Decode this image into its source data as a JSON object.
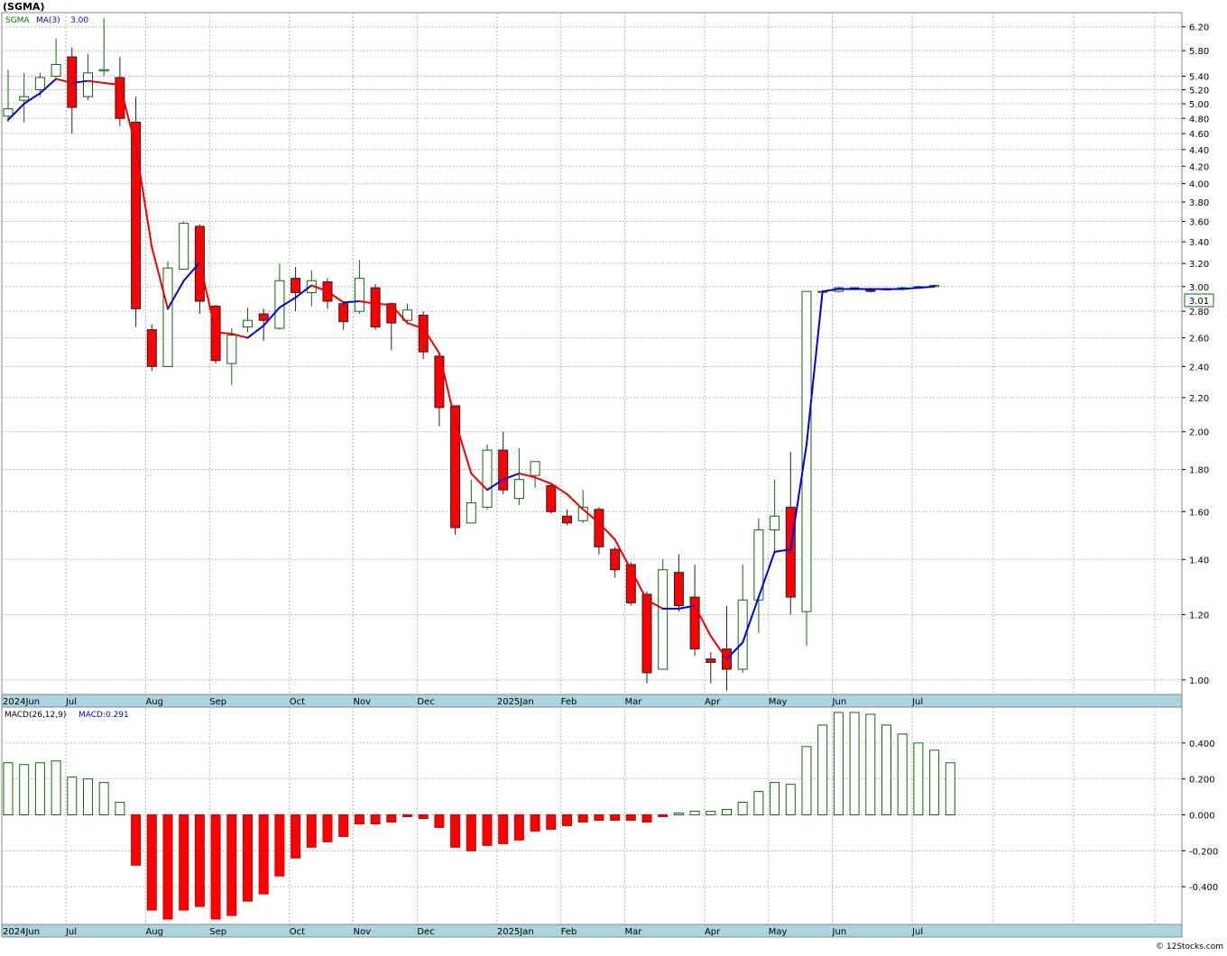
{
  "header": {
    "title": "(SGMA)",
    "legend": [
      {
        "text": "SGMA",
        "color": "#007700"
      },
      {
        "text": "MA(3)",
        "color": "#0000cc"
      },
      {
        "text": "3.00",
        "color": "#0000cc"
      }
    ],
    "last_price": "3.01",
    "footer": "© 12Stocks.com"
  },
  "colors": {
    "up_candle": "#0a6a0a",
    "down_candle": "#ff0000",
    "ma_up": "#0000dd",
    "ma_down": "#ee0000",
    "grid": "#b8b8b8",
    "axis_strip": "#a9d4e0",
    "macd_up": "#0a6a0a",
    "macd_down": "#ff0000"
  },
  "chart_data": [
    {
      "type": "candlestick",
      "scale": "log",
      "ylim": [
        0.96,
        6.45
      ],
      "y_ticks": [
        "1.00",
        "1.20",
        "1.40",
        "1.60",
        "1.80",
        "2.00",
        "2.20",
        "2.40",
        "2.60",
        "2.80",
        "3.00",
        "3.20",
        "3.40",
        "3.60",
        "3.80",
        "4.00",
        "4.20",
        "4.40",
        "4.60",
        "4.80",
        "5.00",
        "5.20",
        "5.40",
        "5.80",
        "6.20"
      ],
      "x_month_labels": [
        {
          "label": "2024Jun",
          "week": 0
        },
        {
          "label": "Jul",
          "week": 4
        },
        {
          "label": "Aug",
          "week": 9
        },
        {
          "label": "Sep",
          "week": 13
        },
        {
          "label": "Oct",
          "week": 18
        },
        {
          "label": "Nov",
          "week": 22
        },
        {
          "label": "Dec",
          "week": 26
        },
        {
          "label": "2025Jan",
          "week": 31
        },
        {
          "label": "Feb",
          "week": 35
        },
        {
          "label": "Mar",
          "week": 39
        },
        {
          "label": "Apr",
          "week": 44
        },
        {
          "label": "May",
          "week": 48
        },
        {
          "label": "Jun",
          "week": 52
        },
        {
          "label": "Jul",
          "week": 57
        }
      ],
      "candles": [
        {
          "o": 4.83,
          "h": 5.5,
          "l": 4.75,
          "c": 4.93
        },
        {
          "o": 5.05,
          "h": 5.45,
          "l": 4.75,
          "c": 5.1
        },
        {
          "o": 5.2,
          "h": 5.45,
          "l": 5.1,
          "c": 5.38
        },
        {
          "o": 5.4,
          "h": 6.0,
          "l": 5.35,
          "c": 5.58
        },
        {
          "o": 5.7,
          "h": 5.85,
          "l": 4.6,
          "c": 4.95
        },
        {
          "o": 5.1,
          "h": 5.75,
          "l": 5.05,
          "c": 5.45
        },
        {
          "o": 5.48,
          "h": 6.35,
          "l": 5.4,
          "c": 5.5
        },
        {
          "o": 5.38,
          "h": 5.7,
          "l": 4.7,
          "c": 4.8
        },
        {
          "o": 4.75,
          "h": 5.1,
          "l": 2.68,
          "c": 2.82
        },
        {
          "o": 2.66,
          "h": 2.7,
          "l": 2.37,
          "c": 2.4
        },
        {
          "o": 2.4,
          "h": 3.22,
          "l": 2.4,
          "c": 3.16
        },
        {
          "o": 3.15,
          "h": 3.6,
          "l": 3.15,
          "c": 3.58
        },
        {
          "o": 3.55,
          "h": 3.57,
          "l": 2.78,
          "c": 2.88
        },
        {
          "o": 2.84,
          "h": 2.85,
          "l": 2.42,
          "c": 2.44
        },
        {
          "o": 2.42,
          "h": 2.67,
          "l": 2.28,
          "c": 2.62
        },
        {
          "o": 2.68,
          "h": 2.83,
          "l": 2.64,
          "c": 2.73
        },
        {
          "o": 2.78,
          "h": 2.82,
          "l": 2.58,
          "c": 2.73
        },
        {
          "o": 2.67,
          "h": 3.2,
          "l": 2.66,
          "c": 3.05
        },
        {
          "o": 3.07,
          "h": 3.17,
          "l": 2.8,
          "c": 2.95
        },
        {
          "o": 2.95,
          "h": 3.14,
          "l": 2.84,
          "c": 3.05
        },
        {
          "o": 3.04,
          "h": 3.07,
          "l": 2.82,
          "c": 2.88
        },
        {
          "o": 2.86,
          "h": 2.88,
          "l": 2.66,
          "c": 2.72
        },
        {
          "o": 2.8,
          "h": 3.23,
          "l": 2.78,
          "c": 3.07
        },
        {
          "o": 2.99,
          "h": 3.02,
          "l": 2.66,
          "c": 2.68
        },
        {
          "o": 2.86,
          "h": 2.87,
          "l": 2.51,
          "c": 2.71
        },
        {
          "o": 2.73,
          "h": 2.86,
          "l": 2.7,
          "c": 2.81
        },
        {
          "o": 2.77,
          "h": 2.8,
          "l": 2.45,
          "c": 2.5
        },
        {
          "o": 2.47,
          "h": 2.47,
          "l": 2.03,
          "c": 2.14
        },
        {
          "o": 2.15,
          "h": 2.15,
          "l": 1.5,
          "c": 1.53
        },
        {
          "o": 1.55,
          "h": 1.75,
          "l": 1.55,
          "c": 1.64
        },
        {
          "o": 1.62,
          "h": 1.93,
          "l": 1.61,
          "c": 1.9
        },
        {
          "o": 1.9,
          "h": 2.0,
          "l": 1.68,
          "c": 1.7
        },
        {
          "o": 1.66,
          "h": 1.91,
          "l": 1.63,
          "c": 1.75
        },
        {
          "o": 1.77,
          "h": 1.84,
          "l": 1.71,
          "c": 1.84
        },
        {
          "o": 1.72,
          "h": 1.73,
          "l": 1.59,
          "c": 1.6
        },
        {
          "o": 1.58,
          "h": 1.61,
          "l": 1.54,
          "c": 1.55
        },
        {
          "o": 1.56,
          "h": 1.7,
          "l": 1.55,
          "c": 1.62
        },
        {
          "o": 1.61,
          "h": 1.62,
          "l": 1.42,
          "c": 1.45
        },
        {
          "o": 1.44,
          "h": 1.45,
          "l": 1.33,
          "c": 1.36
        },
        {
          "o": 1.38,
          "h": 1.39,
          "l": 1.23,
          "c": 1.24
        },
        {
          "o": 1.27,
          "h": 1.28,
          "l": 0.99,
          "c": 1.02
        },
        {
          "o": 1.03,
          "h": 1.4,
          "l": 1.03,
          "c": 1.36
        },
        {
          "o": 1.35,
          "h": 1.42,
          "l": 1.21,
          "c": 1.23
        },
        {
          "o": 1.26,
          "h": 1.38,
          "l": 1.07,
          "c": 1.09
        },
        {
          "o": 1.06,
          "h": 1.08,
          "l": 0.99,
          "c": 1.05
        },
        {
          "o": 1.09,
          "h": 1.23,
          "l": 0.97,
          "c": 1.03
        },
        {
          "o": 1.03,
          "h": 1.38,
          "l": 1.02,
          "c": 1.25
        },
        {
          "o": 1.25,
          "h": 1.57,
          "l": 1.14,
          "c": 1.52
        },
        {
          "o": 1.52,
          "h": 1.75,
          "l": 1.43,
          "c": 1.58
        },
        {
          "o": 1.62,
          "h": 1.89,
          "l": 1.2,
          "c": 1.26
        },
        {
          "o": 1.21,
          "h": 2.96,
          "l": 1.1,
          "c": 2.96
        },
        {
          "o": 2.96,
          "h": 2.97,
          "l": 2.95,
          "c": 2.96
        },
        {
          "o": 2.96,
          "h": 3.0,
          "l": 2.95,
          "c": 2.99
        },
        {
          "o": 2.99,
          "h": 2.99,
          "l": 2.97,
          "c": 2.98
        },
        {
          "o": 2.97,
          "h": 2.99,
          "l": 2.95,
          "c": 2.96
        },
        {
          "o": 2.98,
          "h": 2.99,
          "l": 2.97,
          "c": 2.98
        },
        {
          "o": 2.98,
          "h": 3.0,
          "l": 2.97,
          "c": 2.99
        },
        {
          "o": 2.99,
          "h": 3.01,
          "l": 2.98,
          "c": 3.0
        },
        {
          "o": 3.0,
          "h": 3.02,
          "l": 2.99,
          "c": 3.01
        }
      ],
      "ma3": {
        "name": "MA(3)",
        "values": [
          4.78,
          5.0,
          5.15,
          5.36,
          5.3,
          5.33,
          5.3,
          5.27,
          4.43,
          3.35,
          2.82,
          3.05,
          3.21,
          2.64,
          2.63,
          2.6,
          2.69,
          2.83,
          2.91,
          3.01,
          2.96,
          2.87,
          2.88,
          2.86,
          2.85,
          2.71,
          2.67,
          2.49,
          2.06,
          1.78,
          1.7,
          1.75,
          1.78,
          1.76,
          1.73,
          1.68,
          1.61,
          1.55,
          1.48,
          1.36,
          1.25,
          1.22,
          1.22,
          1.23,
          1.13,
          1.06,
          1.11,
          1.26,
          1.43,
          1.44,
          1.93,
          2.96,
          2.98,
          2.98,
          2.98,
          2.98,
          2.98,
          2.99,
          3.0
        ]
      }
    },
    {
      "type": "bar",
      "name": "MACD(26,12,9)",
      "value_label": "MACD:0.291",
      "ylim": [
        -0.61,
        0.6
      ],
      "y_ticks": [
        "0.400",
        "0.200",
        "0.000",
        "-0.200",
        "-0.400"
      ],
      "values": [
        0.29,
        0.28,
        0.29,
        0.3,
        0.21,
        0.2,
        0.18,
        0.07,
        -0.28,
        -0.53,
        -0.58,
        -0.53,
        -0.51,
        -0.58,
        -0.56,
        -0.48,
        -0.44,
        -0.34,
        -0.24,
        -0.18,
        -0.15,
        -0.12,
        -0.05,
        -0.05,
        -0.04,
        -0.01,
        -0.02,
        -0.07,
        -0.18,
        -0.2,
        -0.17,
        -0.16,
        -0.14,
        -0.09,
        -0.08,
        -0.06,
        -0.04,
        -0.03,
        -0.03,
        -0.03,
        -0.04,
        -0.01,
        0.01,
        0.02,
        0.02,
        0.03,
        0.07,
        0.13,
        0.18,
        0.17,
        0.38,
        0.5,
        0.57,
        0.57,
        0.56,
        0.5,
        0.45,
        0.4,
        0.36,
        0.29
      ]
    }
  ]
}
